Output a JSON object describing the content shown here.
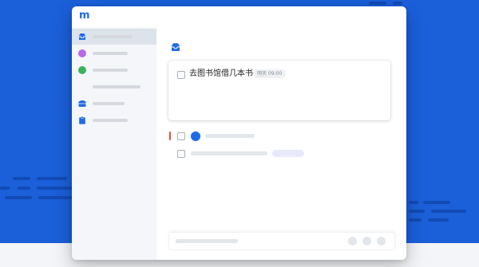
{
  "app": {
    "logo_text": "m",
    "accent_color": "#1f6be8"
  },
  "sidebar": {
    "items": [
      {
        "icon": "inbox-icon",
        "color": "#1f6be8",
        "active": true
      },
      {
        "icon": "purple-dot-icon",
        "color": "#b56be8",
        "active": false
      },
      {
        "icon": "green-dot-icon",
        "color": "#3cb35a",
        "active": false
      },
      {
        "icon": "",
        "active": false
      },
      {
        "icon": "folder-icon",
        "color": "#1f6be8",
        "active": false
      },
      {
        "icon": "clipboard-icon",
        "color": "#1f6be8",
        "active": false
      }
    ]
  },
  "main": {
    "header_icon": "inbox-icon",
    "task_card": {
      "title": "去图书馆借几本书",
      "tag": "明天 09:00"
    }
  },
  "colors": {
    "background_blue": "#1b5fd9",
    "priority_red": "#e84a3f"
  }
}
